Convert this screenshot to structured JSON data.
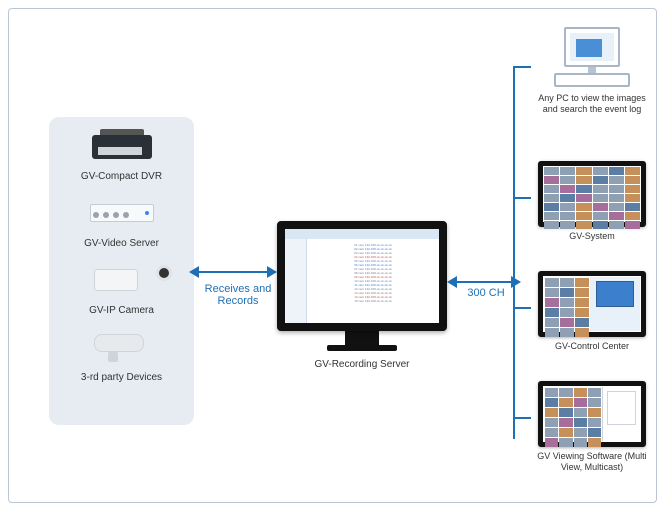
{
  "left": {
    "items": [
      {
        "label": "GV-Compact DVR"
      },
      {
        "label": "GV-Video Server"
      },
      {
        "label": "GV-IP Camera"
      },
      {
        "label": "3-rd party Devices"
      }
    ]
  },
  "center": {
    "link_left_text": "Receives and Records",
    "link_right_text": "300 CH",
    "label": "GV-Recording Server"
  },
  "right": {
    "pc_caption": "Any PC to view the images and search the event log",
    "items": [
      {
        "label": "GV-System"
      },
      {
        "label": "GV-Control Center"
      },
      {
        "label": "GV Viewing Software (Multi View, Multicast)"
      }
    ]
  }
}
